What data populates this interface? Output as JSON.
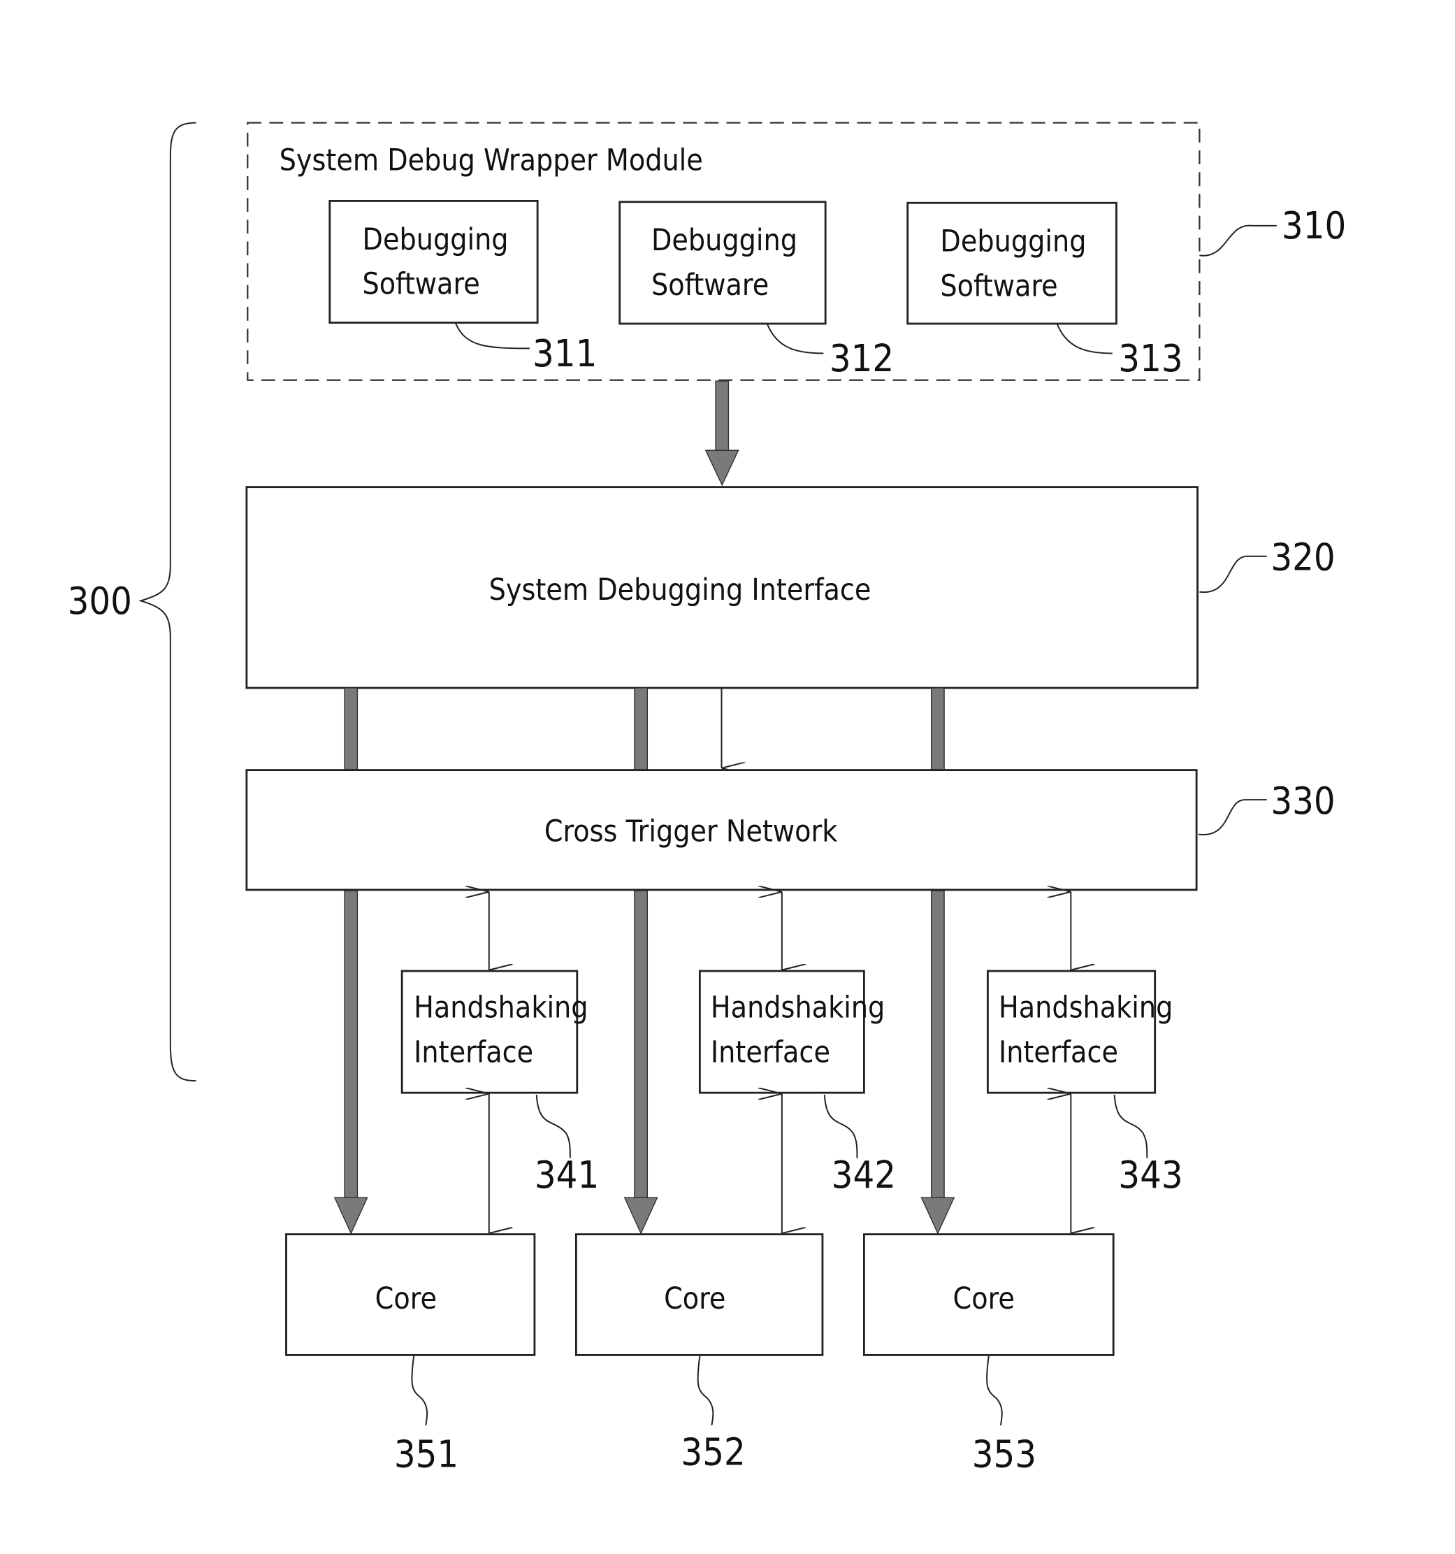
{
  "figure": {
    "system_ref": "300",
    "wrapper": {
      "title": "System Debug Wrapper Module",
      "ref": "310",
      "software": [
        {
          "line1": "Debugging",
          "line2": "Software",
          "ref": "311"
        },
        {
          "line1": "Debugging",
          "line2": "Software",
          "ref": "312"
        },
        {
          "line1": "Debugging",
          "line2": "Software",
          "ref": "313"
        }
      ]
    },
    "debug_interface": {
      "label": "System Debugging Interface",
      "ref": "320"
    },
    "cross_trigger": {
      "label": "Cross Trigger Network",
      "ref": "330"
    },
    "handshaking": [
      {
        "line1": "Handshaking",
        "line2": "Interface",
        "ref": "341"
      },
      {
        "line1": "Handshaking",
        "line2": "Interface",
        "ref": "342"
      },
      {
        "line1": "Handshaking",
        "line2": "Interface",
        "ref": "343"
      }
    ],
    "cores": [
      {
        "label": "Core",
        "ref": "351"
      },
      {
        "label": "Core",
        "ref": "352"
      },
      {
        "label": "Core",
        "ref": "353"
      }
    ]
  }
}
